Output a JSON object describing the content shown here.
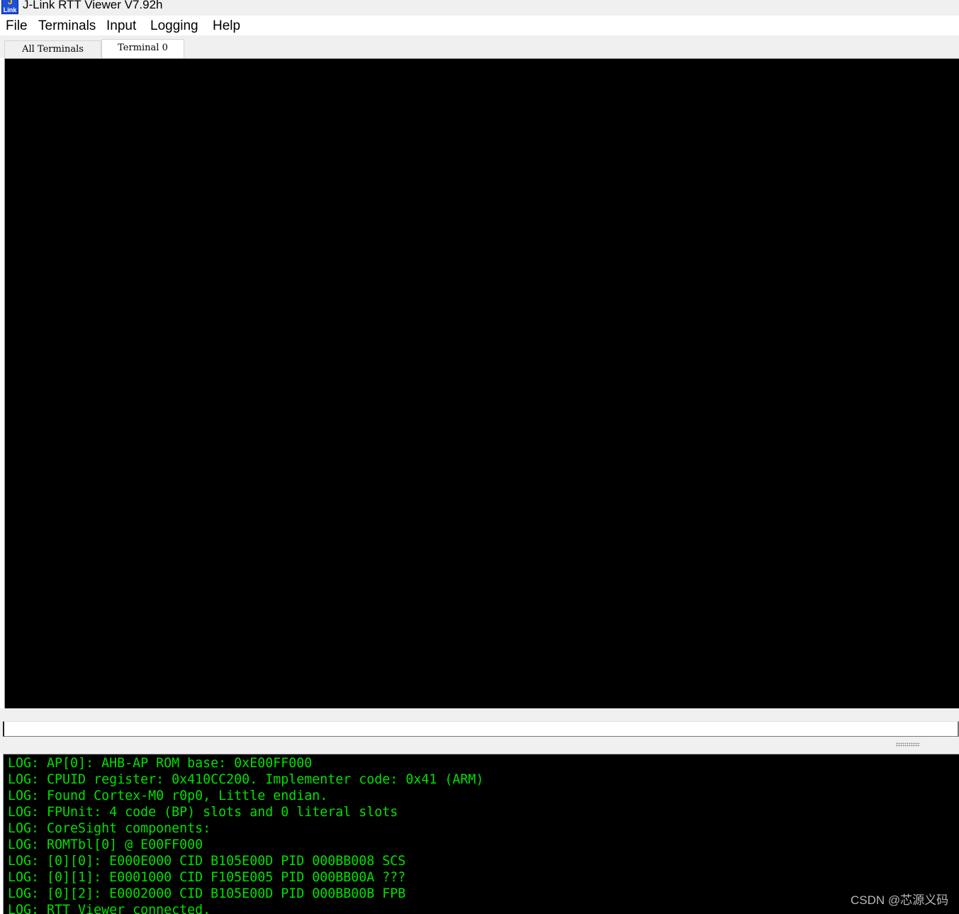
{
  "window": {
    "title": "J-Link RTT Viewer V7.92h",
    "icon_text": "Link"
  },
  "menu": {
    "items": [
      "File",
      "Terminals",
      "Input",
      "Logging",
      "Help"
    ]
  },
  "tabs": [
    {
      "label": "All Terminals",
      "active": false
    },
    {
      "label": "Terminal 0",
      "active": true
    }
  ],
  "input": {
    "value": ""
  },
  "log": {
    "text_color": "#00e000",
    "lines": [
      "LOG: AP[0]: AHB-AP ROM base: 0xE00FF000",
      "LOG: CPUID register: 0x410CC200. Implementer code: 0x41 (ARM)",
      "LOG: Found Cortex-M0 r0p0, Little endian.",
      "LOG: FPUnit: 4 code (BP) slots and 0 literal slots",
      "LOG: CoreSight components:",
      "LOG: ROMTbl[0] @ E00FF000",
      "LOG: [0][0]: E000E000 CID B105E00D PID 000BB008 SCS",
      "LOG: [0][1]: E0001000 CID F105E005 PID 000BB00A ???",
      "LOG: [0][2]: E0002000 CID B105E00D PID 000BB00B FPB",
      "LOG: RTT Viewer connected."
    ]
  },
  "watermark": "CSDN @芯源义码"
}
